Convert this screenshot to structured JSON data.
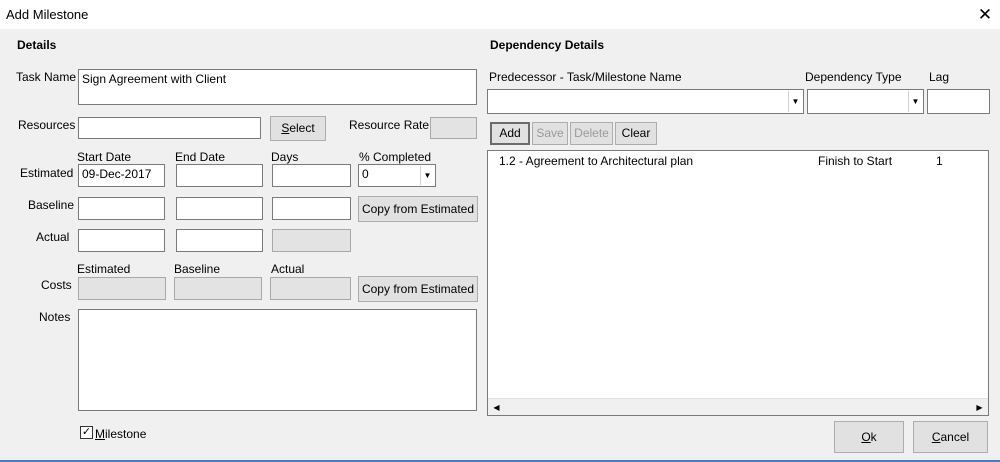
{
  "window": {
    "title": "Add Milestone",
    "close_icon": "close-icon"
  },
  "details": {
    "heading": "Details",
    "task_name_label": "Task Name",
    "task_name_value": "Sign Agreement with Client",
    "resources_label": "Resources",
    "resources_value": "",
    "select_label_pre": "",
    "select_label_key": "S",
    "select_label_post": "elect",
    "resource_rate_label": "Resource Rate",
    "resource_rate_value": "",
    "col_start_date": "Start Date",
    "col_end_date": "End Date",
    "col_days": "Days",
    "col_pct_completed": "% Completed",
    "estimated_label": "Estimated",
    "estimated": {
      "start": "09-Dec-2017",
      "end": "",
      "days": "",
      "pct": "0"
    },
    "baseline_label": "Baseline",
    "baseline": {
      "start": "",
      "end": "",
      "days": ""
    },
    "actual_label": "Actual",
    "actual": {
      "start": "",
      "end": "",
      "days": ""
    },
    "copy_from_estimated_label": "Copy from Estimated",
    "costs_label": "Costs",
    "cost_col_estimated": "Estimated",
    "cost_col_baseline": "Baseline",
    "cost_col_actual": "Actual",
    "costs": {
      "estimated": "",
      "baseline": "",
      "actual": ""
    },
    "notes_label": "Notes",
    "notes_value": "",
    "milestone_key": "M",
    "milestone_rest": "ilestone",
    "milestone_checked": true
  },
  "dependency": {
    "heading": "Dependency Details",
    "predecessor_label": "Predecessor - Task/Milestone Name",
    "dependency_type_label": "Dependency Type",
    "lag_label": "Lag",
    "predecessor_value": "",
    "dependency_type_value": "",
    "lag_value": "",
    "buttons": {
      "add": "Add",
      "save": "Save",
      "delete": "Delete",
      "clear": "Clear"
    },
    "rows": [
      {
        "name": "1.2 - Agreement to Architectural plan",
        "type": "Finish to Start",
        "lag": "1"
      }
    ]
  },
  "footer": {
    "ok_key": "O",
    "ok_rest": "k",
    "cancel_key": "C",
    "cancel_rest": "ancel"
  }
}
